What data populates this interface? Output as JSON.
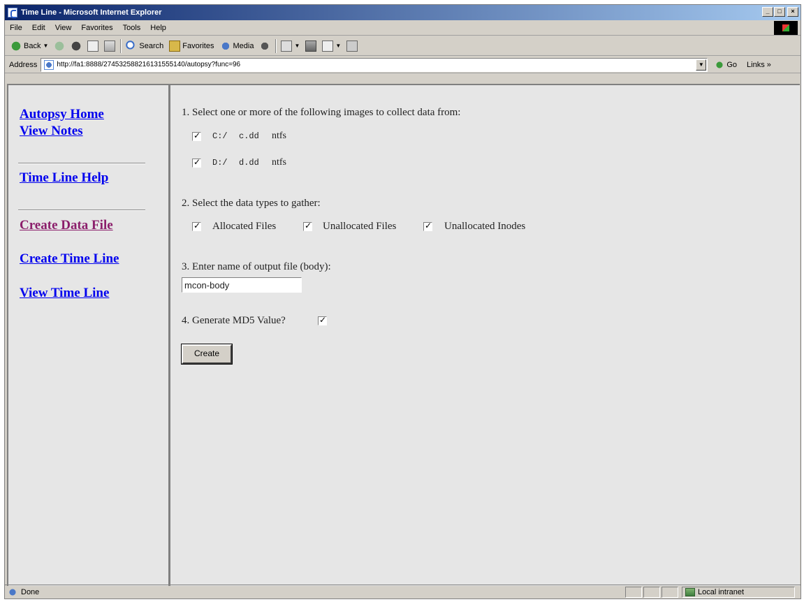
{
  "window": {
    "title": "Time Line - Microsoft Internet Explorer",
    "controls": {
      "minimize": "_",
      "maximize": "□",
      "close": "×"
    }
  },
  "menu": [
    "File",
    "Edit",
    "View",
    "Favorites",
    "Tools",
    "Help"
  ],
  "toolbar": {
    "back_label": "Back",
    "search_label": "Search",
    "favorites_label": "Favorites",
    "media_label": "Media"
  },
  "address": {
    "label": "Address",
    "url": "http://fa1:8888/274532588216131555140/autopsy?func=96",
    "go_label": "Go",
    "links_label": "Links »"
  },
  "sidebar": {
    "links": [
      {
        "label": "Autopsy Home"
      },
      {
        "label": "View Notes"
      },
      {
        "label": "Time Line Help"
      },
      {
        "label": "Create Data File"
      },
      {
        "label": "Create Time Line"
      },
      {
        "label": "View Time Line"
      }
    ]
  },
  "form": {
    "step1": {
      "label": "1. Select one or more of the following images to collect data from:",
      "images": [
        {
          "mount": "C:/",
          "file": "c.dd",
          "fs": "ntfs",
          "checked": true
        },
        {
          "mount": "D:/",
          "file": "d.dd",
          "fs": "ntfs",
          "checked": true
        }
      ]
    },
    "step2": {
      "label": "2. Select the data types to gather:",
      "types": [
        {
          "label": "Allocated Files",
          "checked": true
        },
        {
          "label": "Unallocated Files",
          "checked": true
        },
        {
          "label": "Unallocated Inodes",
          "checked": true
        }
      ]
    },
    "step3": {
      "label": "3. Enter name of output file (body):",
      "value": "mcon-body"
    },
    "step4": {
      "label": "4. Generate MD5 Value?",
      "checked": true
    },
    "create_label": "Create"
  },
  "status": {
    "text": "Done",
    "zone": "Local intranet"
  }
}
